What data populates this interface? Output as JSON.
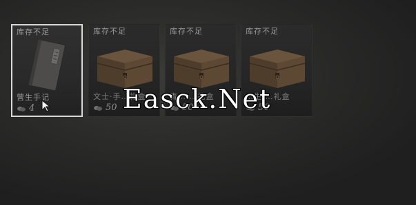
{
  "inventory": {
    "items": [
      {
        "stock_label": "库存不足",
        "name": "营生手记",
        "price": "4",
        "art_icon": "notebook-icon",
        "selected": true
      },
      {
        "stock_label": "库存不足",
        "name": "文士·手…礼盒",
        "price": "50",
        "art_icon": "gift-box-icon",
        "selected": false
      },
      {
        "stock_label": "库存不足",
        "name": "青…·…礼盒",
        "price": "50",
        "art_icon": "gift-box-icon",
        "selected": false
      },
      {
        "stock_label": "库存不足",
        "name": "…生·…礼盒",
        "price": "50",
        "art_icon": "gift-box-icon",
        "selected": false
      }
    ],
    "currency_icon": "coin-icon"
  },
  "watermark": {
    "text": "Easck.Net"
  },
  "colors": {
    "selected_border": "#d9d9d9",
    "background": "#2c2c2b"
  }
}
